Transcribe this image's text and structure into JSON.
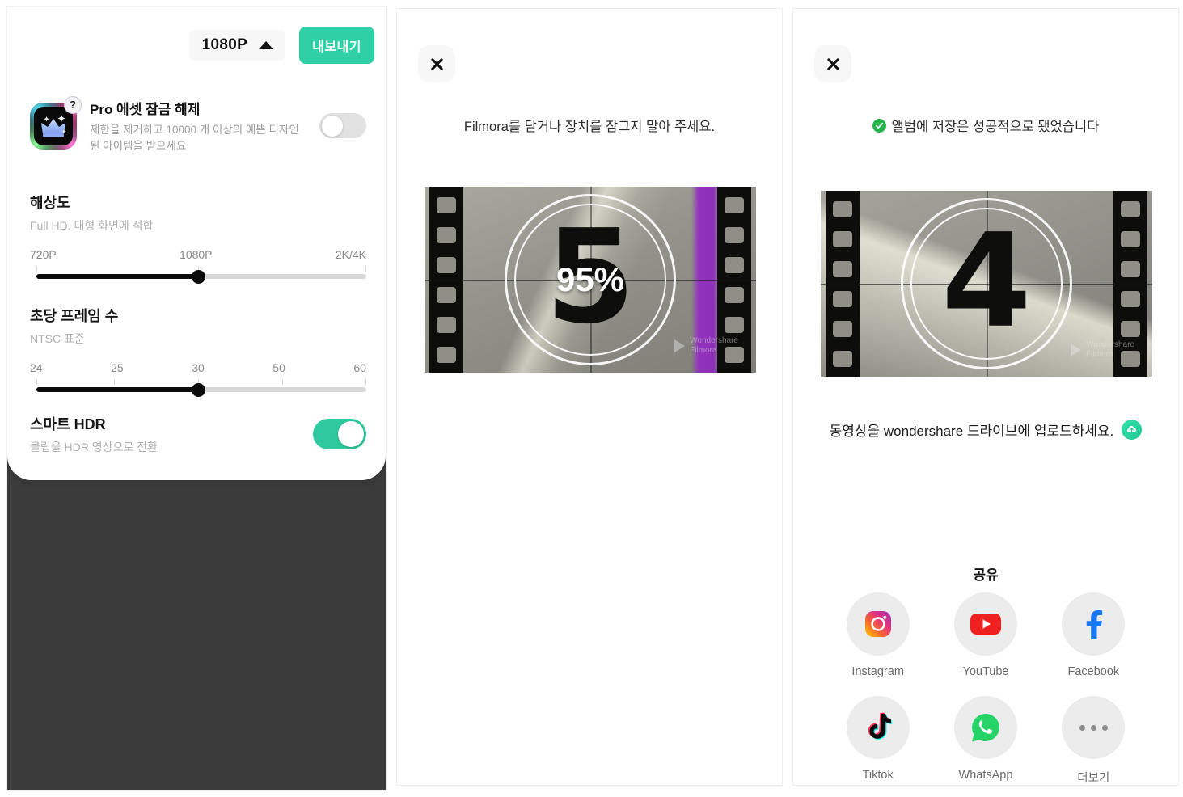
{
  "panel_export": {
    "resolution_chip": {
      "value": "1080P",
      "caret_icon": "caret-up-icon"
    },
    "export_button": "내보내기",
    "pro": {
      "title": "Pro 에셋 잠금 해제",
      "subtitle": "제한을 제거하고 10000 개 이상의 예쁜 디자인된 아이템을 받으세요",
      "help_badge": "?",
      "toggle_state": "off",
      "icon": "pro-crown-icon"
    },
    "resolution": {
      "title": "해상도",
      "subtitle": "Full HD. 대형 화면에 적합",
      "ticks": [
        "720P",
        "1080P",
        "2K/4K"
      ],
      "selected": "1080P",
      "thumb_percent": 50
    },
    "framerate": {
      "title": "초당 프레임 수",
      "subtitle": "NTSC 표준",
      "ticks": [
        "24",
        "25",
        "30",
        "50",
        "60"
      ],
      "selected": "30",
      "thumb_percent": 50
    },
    "smart_hdr": {
      "title": "스마트 HDR",
      "subtitle": "클립을 HDR 영상으로 전환",
      "toggle_state": "on"
    }
  },
  "panel_exporting": {
    "close_icon": "close-icon",
    "status": "Filmora를 닫거나 장치를 잠그지 말아 주세요.",
    "preview": {
      "countdown_number": "5",
      "progress_label": "95%",
      "watermark_line1": "Wondershare",
      "watermark_line2": "Filmora"
    }
  },
  "panel_success": {
    "close_icon": "close-icon",
    "status": "앨범에 저장은 성공적으로 됐었습니다",
    "status_icon": "check-circle-icon",
    "preview": {
      "countdown_number": "4",
      "watermark_line1": "Wondershare",
      "watermark_line2": "Filmora"
    },
    "upload": {
      "text": "동영상을 wondershare 드라이브에 업로드하세요.",
      "icon": "cloud-upload-icon"
    },
    "share": {
      "title": "공유",
      "items": [
        {
          "label": "Instagram",
          "icon": "instagram-icon"
        },
        {
          "label": "YouTube",
          "icon": "youtube-icon"
        },
        {
          "label": "Facebook",
          "icon": "facebook-icon"
        },
        {
          "label": "Tiktok",
          "icon": "tiktok-icon"
        },
        {
          "label": "WhatsApp",
          "icon": "whatsapp-icon"
        },
        {
          "label": "더보기",
          "icon": "more-dots-icon"
        }
      ]
    }
  },
  "colors": {
    "accent_green": "#2fd0a5",
    "toggle_on": "#2fc99f",
    "success_green": "#26b44a",
    "dark_backdrop": "#3b3b3b",
    "slider_fill": "#0b0b0b",
    "slider_track": "#d8d8d8"
  }
}
